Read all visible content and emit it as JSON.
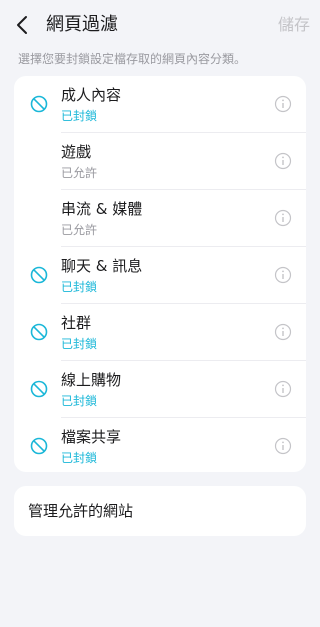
{
  "header": {
    "title": "網頁過濾",
    "save_label": "儲存"
  },
  "description": "選擇您要封鎖設定檔存取的網頁內容分類。",
  "categories": [
    {
      "label": "成人內容",
      "status": "已封鎖",
      "blocked": true
    },
    {
      "label": "遊戲",
      "status": "已允許",
      "blocked": false
    },
    {
      "label": "串流 & 媒體",
      "status": "已允許",
      "blocked": false
    },
    {
      "label": "聊天 & 訊息",
      "status": "已封鎖",
      "blocked": true
    },
    {
      "label": "社群",
      "status": "已封鎖",
      "blocked": true
    },
    {
      "label": "線上購物",
      "status": "已封鎖",
      "blocked": true
    },
    {
      "label": "檔案共享",
      "status": "已封鎖",
      "blocked": true
    }
  ],
  "manage_allowed_sites": {
    "label": "管理允許的網站"
  },
  "colors": {
    "accent": "#1ab7d8",
    "muted": "#9a9aa0",
    "background": "#f3f4f8"
  },
  "icons": {
    "back": "chevron-left-icon",
    "blocked": "block-icon",
    "info": "info-icon"
  }
}
